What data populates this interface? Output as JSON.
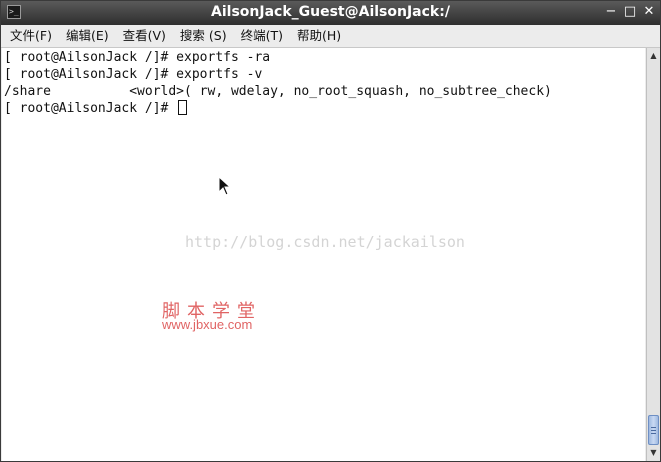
{
  "window": {
    "title": "AilsonJack_Guest@AilsonJack:/",
    "controls": {
      "minimize": "−",
      "maximize": "□",
      "close": "✕"
    }
  },
  "menubar": {
    "items": [
      {
        "label": "文件(F)"
      },
      {
        "label": "编辑(E)"
      },
      {
        "label": "查看(V)"
      },
      {
        "label": "搜索 (S)"
      },
      {
        "label": "终端(T)"
      },
      {
        "label": "帮助(H)"
      }
    ]
  },
  "terminal": {
    "lines": [
      "[ root@AilsonJack /]# exportfs -ra",
      "[ root@AilsonJack /]# exportfs -v",
      "/share          <world>( rw, wdelay, no_root_squash, no_subtree_check)",
      "[ root@AilsonJack /]# "
    ]
  },
  "watermarks": {
    "blog_url": "http://blog.csdn.net/jackailson",
    "site_name_cn": "脚本学堂",
    "site_url": "www.jbxue.com"
  },
  "icons": {
    "app_icon": "terminal-icon",
    "pointer": "mouse-pointer-icon"
  },
  "colors": {
    "titlebar": "#2e2e2e",
    "watermark_red": "#e06464",
    "watermark_gray": "#d4d4d4",
    "scroll_thumb": "#9fb9e0"
  }
}
